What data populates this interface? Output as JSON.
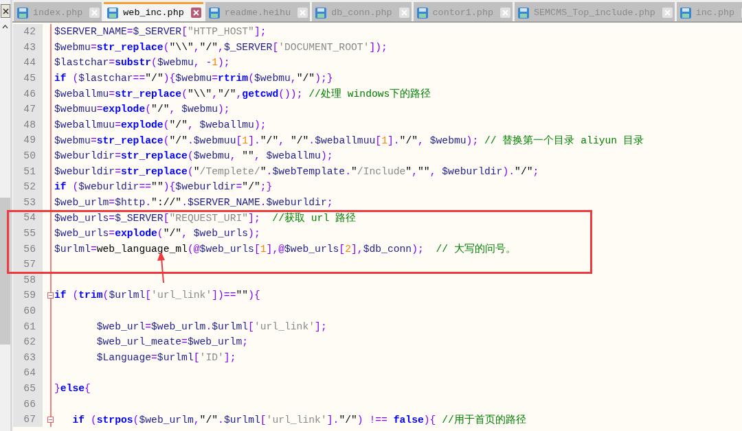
{
  "tabs": [
    {
      "label": "index.php",
      "selected": false
    },
    {
      "label": "web_inc.php",
      "selected": true
    },
    {
      "label": "readme.heihu",
      "selected": false
    },
    {
      "label": "db_conn.php",
      "selected": false
    },
    {
      "label": "contor1.php",
      "selected": false
    },
    {
      "label": "SEMCMS_Top_include.php",
      "selected": false
    },
    {
      "label": "inc.php",
      "selected": false
    }
  ],
  "lines": [
    {
      "number": "42",
      "fold": false,
      "tokens": [
        {
          "kind": "v",
          "text": "$SERVER_NAME"
        },
        {
          "kind": "o",
          "text": "="
        },
        {
          "kind": "v",
          "text": "$_SERVER"
        },
        {
          "kind": "o",
          "text": "["
        },
        {
          "kind": "s",
          "text": "\"HTTP_HOST\""
        },
        {
          "kind": "o",
          "text": "];"
        }
      ]
    },
    {
      "number": "43",
      "fold": false,
      "tokens": [
        {
          "kind": "v",
          "text": "$webmu"
        },
        {
          "kind": "o",
          "text": "="
        },
        {
          "kind": "f",
          "text": "str_replace"
        },
        {
          "kind": "o",
          "text": "("
        },
        {
          "kind": "q",
          "text": "\"\\\\\""
        },
        {
          "kind": "o",
          "text": ","
        },
        {
          "kind": "q",
          "text": "\"/\""
        },
        {
          "kind": "o",
          "text": ","
        },
        {
          "kind": "v",
          "text": "$_SERVER"
        },
        {
          "kind": "o",
          "text": "["
        },
        {
          "kind": "s",
          "text": "'DOCUMENT_ROOT'"
        },
        {
          "kind": "o",
          "text": "]);"
        }
      ]
    },
    {
      "number": "44",
      "fold": false,
      "tokens": [
        {
          "kind": "v",
          "text": "$lastchar"
        },
        {
          "kind": "o",
          "text": "="
        },
        {
          "kind": "f",
          "text": "substr"
        },
        {
          "kind": "o",
          "text": "("
        },
        {
          "kind": "v",
          "text": "$webmu"
        },
        {
          "kind": "o",
          "text": ", -"
        },
        {
          "kind": "n",
          "text": "1"
        },
        {
          "kind": "o",
          "text": ");"
        }
      ]
    },
    {
      "number": "45",
      "fold": false,
      "tokens": [
        {
          "kind": "k",
          "text": "if"
        },
        {
          "kind": "o",
          "text": " ("
        },
        {
          "kind": "v",
          "text": "$lastchar"
        },
        {
          "kind": "o",
          "text": "=="
        },
        {
          "kind": "q",
          "text": "\"/\""
        },
        {
          "kind": "o",
          "text": "){"
        },
        {
          "kind": "v",
          "text": "$webmu"
        },
        {
          "kind": "o",
          "text": "="
        },
        {
          "kind": "f",
          "text": "rtrim"
        },
        {
          "kind": "o",
          "text": "("
        },
        {
          "kind": "v",
          "text": "$webmu"
        },
        {
          "kind": "o",
          "text": ","
        },
        {
          "kind": "q",
          "text": "\"/\""
        },
        {
          "kind": "o",
          "text": ");}"
        }
      ]
    },
    {
      "number": "46",
      "fold": false,
      "tokens": [
        {
          "kind": "v",
          "text": "$weballmu"
        },
        {
          "kind": "o",
          "text": "="
        },
        {
          "kind": "f",
          "text": "str_replace"
        },
        {
          "kind": "o",
          "text": "("
        },
        {
          "kind": "q",
          "text": "\"\\\\\""
        },
        {
          "kind": "o",
          "text": ","
        },
        {
          "kind": "q",
          "text": "\"/\""
        },
        {
          "kind": "o",
          "text": ","
        },
        {
          "kind": "f",
          "text": "getcwd"
        },
        {
          "kind": "o",
          "text": "()); "
        },
        {
          "kind": "c",
          "text": "//处理 windows下的路径"
        }
      ]
    },
    {
      "number": "47",
      "fold": false,
      "tokens": [
        {
          "kind": "v",
          "text": "$webmuu"
        },
        {
          "kind": "o",
          "text": "="
        },
        {
          "kind": "f",
          "text": "explode"
        },
        {
          "kind": "o",
          "text": "("
        },
        {
          "kind": "q",
          "text": "\"/\""
        },
        {
          "kind": "o",
          "text": ","
        },
        {
          "kind": "v",
          "text": " $webmu"
        },
        {
          "kind": "o",
          "text": ");"
        }
      ]
    },
    {
      "number": "48",
      "fold": false,
      "tokens": [
        {
          "kind": "v",
          "text": "$weballmuu"
        },
        {
          "kind": "o",
          "text": "="
        },
        {
          "kind": "f",
          "text": "explode"
        },
        {
          "kind": "o",
          "text": "("
        },
        {
          "kind": "q",
          "text": "\"/\""
        },
        {
          "kind": "o",
          "text": ","
        },
        {
          "kind": "v",
          "text": " $weballmu"
        },
        {
          "kind": "o",
          "text": ");"
        }
      ]
    },
    {
      "number": "49",
      "fold": false,
      "tokens": [
        {
          "kind": "v",
          "text": "$webmu"
        },
        {
          "kind": "o",
          "text": "="
        },
        {
          "kind": "f",
          "text": "str_replace"
        },
        {
          "kind": "o",
          "text": "("
        },
        {
          "kind": "q",
          "text": "\"/\""
        },
        {
          "kind": "o",
          "text": "."
        },
        {
          "kind": "v",
          "text": "$webmuu"
        },
        {
          "kind": "o",
          "text": "["
        },
        {
          "kind": "n",
          "text": "1"
        },
        {
          "kind": "o",
          "text": "]."
        },
        {
          "kind": "q",
          "text": "\"/\""
        },
        {
          "kind": "o",
          "text": ","
        },
        {
          "kind": "q",
          "text": " \"/\""
        },
        {
          "kind": "o",
          "text": "."
        },
        {
          "kind": "v",
          "text": "$weballmuu"
        },
        {
          "kind": "o",
          "text": "["
        },
        {
          "kind": "n",
          "text": "1"
        },
        {
          "kind": "o",
          "text": "]."
        },
        {
          "kind": "q",
          "text": "\"/\""
        },
        {
          "kind": "o",
          "text": ","
        },
        {
          "kind": "v",
          "text": " $webmu"
        },
        {
          "kind": "o",
          "text": "); "
        },
        {
          "kind": "c",
          "text": "// 替换第一个目录 aliyun 目录"
        }
      ]
    },
    {
      "number": "50",
      "fold": false,
      "tokens": [
        {
          "kind": "v",
          "text": "$weburldir"
        },
        {
          "kind": "o",
          "text": "="
        },
        {
          "kind": "f",
          "text": "str_replace"
        },
        {
          "kind": "o",
          "text": "("
        },
        {
          "kind": "v",
          "text": "$webmu"
        },
        {
          "kind": "o",
          "text": ","
        },
        {
          "kind": "q",
          "text": " \"\""
        },
        {
          "kind": "o",
          "text": ","
        },
        {
          "kind": "v",
          "text": " $weballmu"
        },
        {
          "kind": "o",
          "text": ");"
        }
      ]
    },
    {
      "number": "51",
      "fold": false,
      "tokens": [
        {
          "kind": "v",
          "text": "$weburldir"
        },
        {
          "kind": "o",
          "text": "="
        },
        {
          "kind": "f",
          "text": "str_replace"
        },
        {
          "kind": "o",
          "text": "("
        },
        {
          "kind": "q",
          "text": "\""
        },
        {
          "kind": "s",
          "text": "/Templete/"
        },
        {
          "kind": "q",
          "text": "\""
        },
        {
          "kind": "o",
          "text": "."
        },
        {
          "kind": "v",
          "text": "$webTemplate"
        },
        {
          "kind": "o",
          "text": "."
        },
        {
          "kind": "q",
          "text": "\""
        },
        {
          "kind": "s",
          "text": "/Include"
        },
        {
          "kind": "q",
          "text": "\""
        },
        {
          "kind": "o",
          "text": ","
        },
        {
          "kind": "q",
          "text": "\"\""
        },
        {
          "kind": "o",
          "text": ","
        },
        {
          "kind": "v",
          "text": " $weburldir"
        },
        {
          "kind": "o",
          "text": ")."
        },
        {
          "kind": "q",
          "text": "\"/\""
        },
        {
          "kind": "o",
          "text": ";"
        }
      ]
    },
    {
      "number": "52",
      "fold": false,
      "tokens": [
        {
          "kind": "k",
          "text": "if"
        },
        {
          "kind": "o",
          "text": " ("
        },
        {
          "kind": "v",
          "text": "$weburldir"
        },
        {
          "kind": "o",
          "text": "=="
        },
        {
          "kind": "q",
          "text": "\"\""
        },
        {
          "kind": "o",
          "text": "){"
        },
        {
          "kind": "v",
          "text": "$weburldir"
        },
        {
          "kind": "o",
          "text": "="
        },
        {
          "kind": "q",
          "text": "\"/\""
        },
        {
          "kind": "o",
          "text": ";}"
        }
      ]
    },
    {
      "number": "53",
      "fold": false,
      "tokens": [
        {
          "kind": "v",
          "text": "$web_urlm"
        },
        {
          "kind": "o",
          "text": "="
        },
        {
          "kind": "v",
          "text": "$http"
        },
        {
          "kind": "o",
          "text": "."
        },
        {
          "kind": "q",
          "text": "\"://\""
        },
        {
          "kind": "o",
          "text": "."
        },
        {
          "kind": "v",
          "text": "$SERVER_NAME"
        },
        {
          "kind": "o",
          "text": "."
        },
        {
          "kind": "v",
          "text": "$weburldir"
        },
        {
          "kind": "o",
          "text": ";"
        }
      ]
    },
    {
      "number": "54",
      "fold": false,
      "tokens": [
        {
          "kind": "v",
          "text": "$web_urls"
        },
        {
          "kind": "o",
          "text": "="
        },
        {
          "kind": "v",
          "text": "$_SERVER"
        },
        {
          "kind": "o",
          "text": "["
        },
        {
          "kind": "s",
          "text": "\"REQUEST_URI\""
        },
        {
          "kind": "o",
          "text": "];  "
        },
        {
          "kind": "c",
          "text": "//获取 url 路径"
        }
      ]
    },
    {
      "number": "55",
      "fold": false,
      "tokens": [
        {
          "kind": "v",
          "text": "$web_urls"
        },
        {
          "kind": "o",
          "text": "="
        },
        {
          "kind": "f",
          "text": "explode"
        },
        {
          "kind": "o",
          "text": "("
        },
        {
          "kind": "q",
          "text": "\"/\""
        },
        {
          "kind": "o",
          "text": ","
        },
        {
          "kind": "v",
          "text": " $web_urls"
        },
        {
          "kind": "o",
          "text": ");"
        }
      ]
    },
    {
      "number": "56",
      "fold": false,
      "tokens": [
        {
          "kind": "v",
          "text": "$urlml"
        },
        {
          "kind": "o",
          "text": "="
        },
        {
          "kind": "p",
          "text": "web_language_ml"
        },
        {
          "kind": "o",
          "text": "(@"
        },
        {
          "kind": "v",
          "text": "$web_urls"
        },
        {
          "kind": "o",
          "text": "["
        },
        {
          "kind": "n",
          "text": "1"
        },
        {
          "kind": "o",
          "text": "],@"
        },
        {
          "kind": "v",
          "text": "$web_urls"
        },
        {
          "kind": "o",
          "text": "["
        },
        {
          "kind": "n",
          "text": "2"
        },
        {
          "kind": "o",
          "text": "],"
        },
        {
          "kind": "v",
          "text": "$db_conn"
        },
        {
          "kind": "o",
          "text": ");  "
        },
        {
          "kind": "c",
          "text": "// 大写的问号。"
        }
      ]
    },
    {
      "number": "57",
      "fold": false
    },
    {
      "number": "58",
      "fold": false
    },
    {
      "number": "59",
      "fold": true,
      "tokens": [
        {
          "kind": "k",
          "text": "if"
        },
        {
          "kind": "o",
          "text": " ("
        },
        {
          "kind": "f",
          "text": "trim"
        },
        {
          "kind": "o",
          "text": "("
        },
        {
          "kind": "v",
          "text": "$urlml"
        },
        {
          "kind": "o",
          "text": "["
        },
        {
          "kind": "s",
          "text": "'url_link'"
        },
        {
          "kind": "o",
          "text": "])=="
        },
        {
          "kind": "q",
          "text": "\"\""
        },
        {
          "kind": "o",
          "text": "){"
        }
      ]
    },
    {
      "number": "60",
      "fold": false
    },
    {
      "number": "61",
      "fold": false,
      "tokens": [
        {
          "kind": "v",
          "text": "       $web_url"
        },
        {
          "kind": "o",
          "text": "="
        },
        {
          "kind": "v",
          "text": "$web_urlm"
        },
        {
          "kind": "o",
          "text": "."
        },
        {
          "kind": "v",
          "text": "$urlml"
        },
        {
          "kind": "o",
          "text": "["
        },
        {
          "kind": "s",
          "text": "'url_link'"
        },
        {
          "kind": "o",
          "text": "];"
        }
      ]
    },
    {
      "number": "62",
      "fold": false,
      "tokens": [
        {
          "kind": "v",
          "text": "       $web_url_meate"
        },
        {
          "kind": "o",
          "text": "="
        },
        {
          "kind": "v",
          "text": "$web_urlm"
        },
        {
          "kind": "o",
          "text": ";"
        }
      ]
    },
    {
      "number": "63",
      "fold": false,
      "tokens": [
        {
          "kind": "v",
          "text": "       $Language"
        },
        {
          "kind": "o",
          "text": "="
        },
        {
          "kind": "v",
          "text": "$urlml"
        },
        {
          "kind": "o",
          "text": "["
        },
        {
          "kind": "s",
          "text": "'ID'"
        },
        {
          "kind": "o",
          "text": "];"
        }
      ]
    },
    {
      "number": "64",
      "fold": false
    },
    {
      "number": "65",
      "fold": false,
      "tokens": [
        {
          "kind": "o",
          "text": "}"
        },
        {
          "kind": "k",
          "text": "else"
        },
        {
          "kind": "o",
          "text": "{"
        }
      ]
    },
    {
      "number": "66",
      "fold": false
    },
    {
      "number": "67",
      "fold": true,
      "tokens": [
        {
          "kind": "k",
          "text": "   if"
        },
        {
          "kind": "o",
          "text": " ("
        },
        {
          "kind": "f",
          "text": "strpos"
        },
        {
          "kind": "o",
          "text": "("
        },
        {
          "kind": "v",
          "text": "$web_urlm"
        },
        {
          "kind": "o",
          "text": ","
        },
        {
          "kind": "q",
          "text": "\"/\""
        },
        {
          "kind": "o",
          "text": "."
        },
        {
          "kind": "v",
          "text": "$urlml"
        },
        {
          "kind": "o",
          "text": "["
        },
        {
          "kind": "s",
          "text": "'url_link'"
        },
        {
          "kind": "o",
          "text": "]."
        },
        {
          "kind": "q",
          "text": "\"/\""
        },
        {
          "kind": "o",
          "text": ") !== "
        },
        {
          "kind": "k",
          "text": "false"
        },
        {
          "kind": "o",
          "text": "){ "
        },
        {
          "kind": "c",
          "text": "//用于首页的路径"
        }
      ]
    }
  ]
}
